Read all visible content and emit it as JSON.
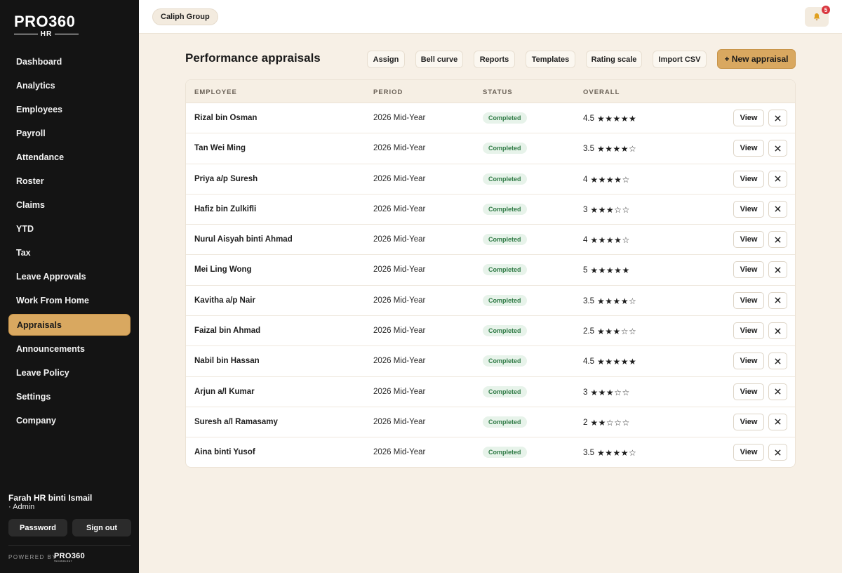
{
  "brand": {
    "logo_main": "PRO360",
    "logo_sub": "HR"
  },
  "sidebar": {
    "items": [
      {
        "label": "Dashboard",
        "active": false
      },
      {
        "label": "Analytics",
        "active": false
      },
      {
        "label": "Employees",
        "active": false
      },
      {
        "label": "Payroll",
        "active": false
      },
      {
        "label": "Attendance",
        "active": false
      },
      {
        "label": "Roster",
        "active": false
      },
      {
        "label": "Claims",
        "active": false
      },
      {
        "label": "YTD",
        "active": false
      },
      {
        "label": "Tax",
        "active": false
      },
      {
        "label": "Leave Approvals",
        "active": false
      },
      {
        "label": "Work From Home",
        "active": false
      },
      {
        "label": "Appraisals",
        "active": true
      },
      {
        "label": "Announcements",
        "active": false
      },
      {
        "label": "Leave Policy",
        "active": false
      },
      {
        "label": "Settings",
        "active": false
      },
      {
        "label": "Company",
        "active": false
      }
    ],
    "user_name": "Farah HR binti Ismail",
    "user_role": "· Admin",
    "password_label": "Password",
    "signout_label": "Sign out",
    "powered_by": "POWERED BY",
    "powered_logo": "PRO360",
    "powered_logo_sub": "TECHNOLOGY"
  },
  "topbar": {
    "org": "Caliph Group",
    "notification_count": "5",
    "bell_icon": "bell-icon"
  },
  "main": {
    "title": "Performance appraisals",
    "toolbar": [
      "Assign",
      "Bell curve",
      "Reports",
      "Templates",
      "Rating scale",
      "Import CSV"
    ],
    "new_label": "+ New appraisal"
  },
  "table": {
    "headers": {
      "employee": "EMPLOYEE",
      "period": "PERIOD",
      "status": "STATUS",
      "overall": "OVERALL"
    },
    "view_label": "View",
    "delete_icon": "close-icon",
    "rows": [
      {
        "employee": "Rizal bin Osman",
        "period": "2026 Mid-Year",
        "status": "Completed",
        "overall": "4.5",
        "stars": "★★★★★"
      },
      {
        "employee": "Tan Wei Ming",
        "period": "2026 Mid-Year",
        "status": "Completed",
        "overall": "3.5",
        "stars": "★★★★☆"
      },
      {
        "employee": "Priya a/p Suresh",
        "period": "2026 Mid-Year",
        "status": "Completed",
        "overall": "4",
        "stars": "★★★★☆"
      },
      {
        "employee": "Hafiz bin Zulkifli",
        "period": "2026 Mid-Year",
        "status": "Completed",
        "overall": "3",
        "stars": "★★★☆☆"
      },
      {
        "employee": "Nurul Aisyah binti Ahmad",
        "period": "2026 Mid-Year",
        "status": "Completed",
        "overall": "4",
        "stars": "★★★★☆"
      },
      {
        "employee": "Mei Ling Wong",
        "period": "2026 Mid-Year",
        "status": "Completed",
        "overall": "5",
        "stars": "★★★★★"
      },
      {
        "employee": "Kavitha a/p Nair",
        "period": "2026 Mid-Year",
        "status": "Completed",
        "overall": "3.5",
        "stars": "★★★★☆"
      },
      {
        "employee": "Faizal bin Ahmad",
        "period": "2026 Mid-Year",
        "status": "Completed",
        "overall": "2.5",
        "stars": "★★★☆☆"
      },
      {
        "employee": "Nabil bin Hassan",
        "period": "2026 Mid-Year",
        "status": "Completed",
        "overall": "4.5",
        "stars": "★★★★★"
      },
      {
        "employee": "Arjun a/l Kumar",
        "period": "2026 Mid-Year",
        "status": "Completed",
        "overall": "3",
        "stars": "★★★☆☆"
      },
      {
        "employee": "Suresh a/l Ramasamy",
        "period": "2026 Mid-Year",
        "status": "Completed",
        "overall": "2",
        "stars": "★★☆☆☆"
      },
      {
        "employee": "Aina binti Yusof",
        "period": "2026 Mid-Year",
        "status": "Completed",
        "overall": "3.5",
        "stars": "★★★★☆"
      }
    ]
  },
  "colors": {
    "accent": "#d9a860",
    "sidebar_bg": "#141414",
    "page_bg": "#f7f0e6",
    "status_green": "#2f7a45",
    "badge_red": "#d9363e"
  }
}
